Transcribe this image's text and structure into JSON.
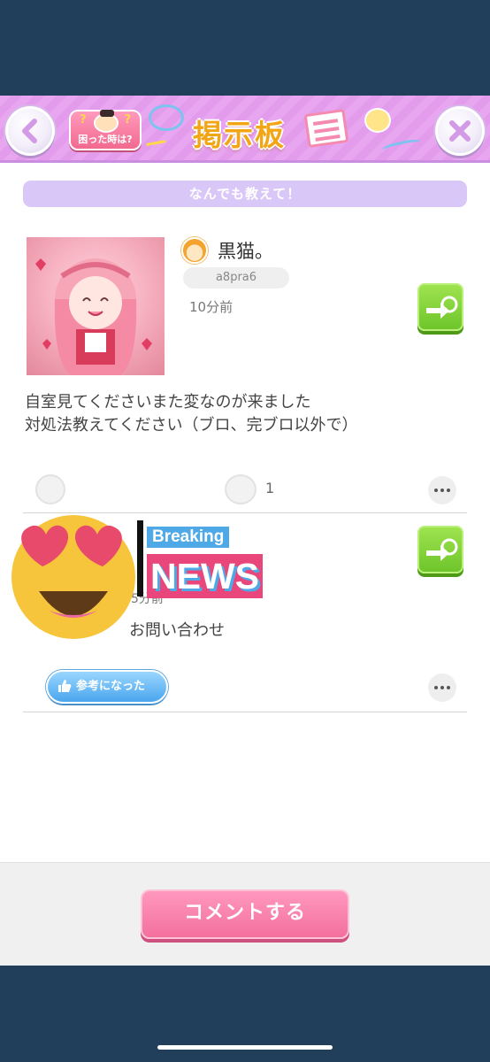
{
  "header": {
    "title": "掲示板",
    "help_label": "困った時は?",
    "help_marks": "?"
  },
  "category": "なんでも教えて！",
  "post": {
    "author_name": "黒猫。",
    "user_id": "a8pra6",
    "time": "10分前",
    "body": "自室見てくださいまた変なのが来ました\n対処法教えてください（ブロ、完ブロ以外で）",
    "comment_count": "1"
  },
  "reply": {
    "time": "5分前",
    "body": "お問い合わせ",
    "helpful_label": "参考になった"
  },
  "sticker": {
    "breaking": "Breaking",
    "news": "NEWS"
  },
  "footer": {
    "comment_button": "コメントする"
  },
  "colors": {
    "background": "#213f5a",
    "accent_pink": "#f3709d",
    "category_purple": "#d9c7f7",
    "friend_green": "#6fc52b",
    "helpful_blue": "#4aa6ee"
  }
}
